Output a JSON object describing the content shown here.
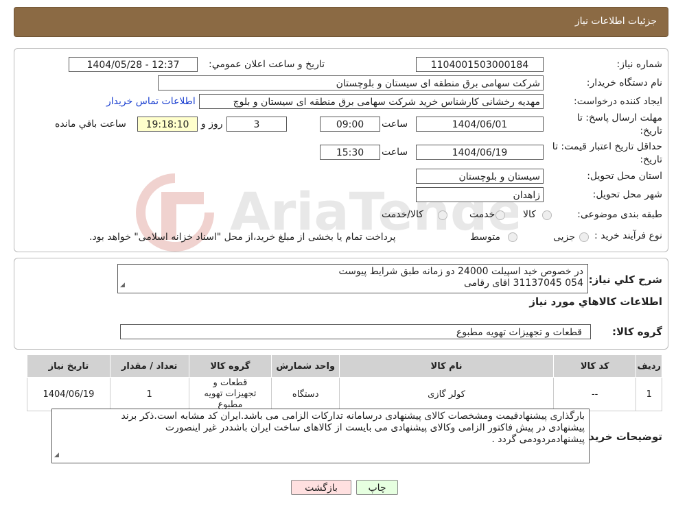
{
  "header": {
    "title": "جزئیات اطلاعات نیاز"
  },
  "form": {
    "need_number_label": "شماره نیاز:",
    "need_number": "1104001503000184",
    "announce_label": "تاریخ و ساعت اعلان عمومي:",
    "announce_value": "1404/05/28 - 12:37",
    "buyer_label": "نام دستگاه خريدار:",
    "buyer_value": "شرکت سهامی برق منطقه ای سیستان و بلوچستان",
    "creator_label": "ايجاد کننده درخواست:",
    "creator_value": "مهدیه رخشانی کارشناس خرید شرکت سهامی برق منطقه ای سیستان و بلوچ",
    "contact_link": "اطلاعات تماس خريدار",
    "reply_deadline_label_1": "مهلت ارسال پاسخ: تا",
    "reply_deadline_label_2": "تاریخ:",
    "reply_date": "1404/06/01",
    "time_label": "ساعت",
    "reply_time": "09:00",
    "days_value": "3",
    "days_label": "روز و",
    "remaining_time": "19:18:10",
    "remaining_label": "ساعت باقي مانده",
    "validity_label_1": "حداقل تاريخ اعتبار قيمت: تا",
    "validity_label_2": "تاريخ:",
    "validity_date": "1404/06/19",
    "validity_time": "15:30",
    "province_label": "استان محل تحویل:",
    "province_value": "سیستان و بلوچستان",
    "city_label": "شهر محل تحویل:",
    "city_value": "زاهدان",
    "category_label": "طبقه بندی موضوعی:",
    "category_options": [
      "کالا",
      "خدمت",
      "کالا/خدمت"
    ],
    "process_label": "نوع فرآیند خرید :",
    "process_options": [
      "جزیی",
      "متوسط"
    ],
    "process_note": "پرداخت تمام یا بخشی از مبلغ خرید،از محل \"اسناد خزانه اسلامی\" خواهد بود."
  },
  "description": {
    "label": "شرح کلي نياز:",
    "lines": [
      "در خصوص خید اسپیلت 24000 دو زمانه طبق شرایط پیوست",
      "054 31137045 اقای رقامی"
    ]
  },
  "goods": {
    "section_title": "اطلاعات کالاهاي مورد نياز",
    "group_label": "گروه کالا:",
    "group_value": "قطعات و تجهیزات تهویه مطبوع",
    "columns": [
      "رديف",
      "کد کالا",
      "نام کالا",
      "واحد شمارش",
      "گروه کالا",
      "تعداد / مقدار",
      "تاريخ نياز"
    ],
    "rows": [
      {
        "row": "1",
        "code": "--",
        "name": "کولر گازی",
        "unit": "دستگاه",
        "group": "قطعات و تجهیزات تهویه مطبوع",
        "qty": "1",
        "date": "1404/06/19"
      }
    ]
  },
  "buyer_notes": {
    "label": "توضيحات خريدار:",
    "lines": [
      "بارگذاری پیشنهادقیمت ومشخصات کالای پیشنهادی درسامانه تدارکات الزامی می باشد.ایران کد مشابه است.ذکر برند",
      "پیشنهادی در پیش فاکتور الزامی وکالای پیشنهادی می بایست از کالاهای ساخت ایران باشددر غیر اینصورت",
      "پیشنهادمردودمی گردد ."
    ]
  },
  "buttons": {
    "print": "چاپ",
    "back": "بازگشت"
  },
  "watermark": {
    "text": "AriaTender.neT"
  },
  "colors": {
    "header_bg": "#8b6a44",
    "link": "#1a3fd0",
    "remaining_bg": "#ffffcc",
    "back_bg": "#ffe0e0",
    "print_bg": "#e6ffe0"
  }
}
